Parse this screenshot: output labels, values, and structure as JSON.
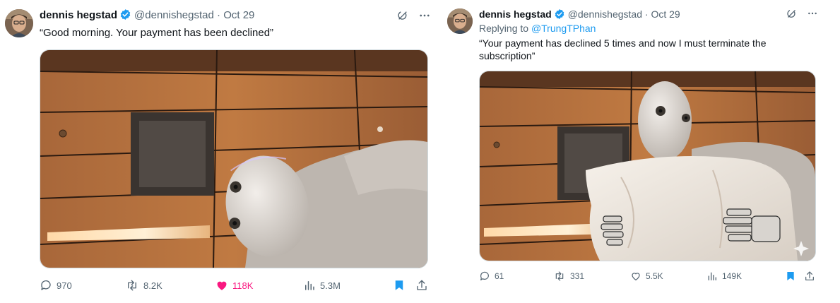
{
  "tweets": [
    {
      "author": {
        "name": "dennis hegstad",
        "handle": "@dennishegstad",
        "separator": "·",
        "date": "Oct 29"
      },
      "text": "“Good morning. Your payment has been declined”",
      "stats": {
        "replies": "970",
        "retweets": "8.2K",
        "likes": "118K",
        "views": "5.3M"
      },
      "liked": true,
      "icons": {
        "grok": "grok-icon",
        "more": "more-icon",
        "reply": "reply-icon",
        "retweet": "retweet-icon",
        "like": "heart-filled-icon",
        "views": "views-icon",
        "bookmark": "bookmark-filled-icon",
        "share": "share-icon"
      },
      "colors": {
        "like": "#f91880",
        "bookmark": "#1d9bf0",
        "verified": "#1d9bf0"
      }
    },
    {
      "author": {
        "name": "dennis hegstad",
        "handle": "@dennishegstad",
        "separator": "·",
        "date": "Oct 29"
      },
      "reply_prefix": "Replying to",
      "reply_to": "@TrungTPhan",
      "text": "“Your payment has declined 5 times and now I must terminate the subscription”",
      "stats": {
        "replies": "61",
        "retweets": "331",
        "likes": "5.5K",
        "views": "149K"
      },
      "liked": false,
      "icons": {
        "grok": "grok-icon",
        "more": "more-icon",
        "reply": "reply-icon",
        "retweet": "retweet-icon",
        "like": "heart-outline-icon",
        "views": "views-icon",
        "bookmark": "bookmark-filled-icon",
        "share": "share-icon"
      },
      "colors": {
        "like": "#536471",
        "bookmark": "#1d9bf0",
        "verified": "#1d9bf0"
      }
    }
  ]
}
